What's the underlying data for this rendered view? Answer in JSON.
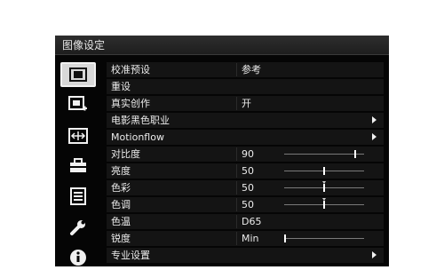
{
  "menu": {
    "title": "图像设定"
  },
  "sidebar": {
    "tabs": [
      {
        "icon": "picture-icon",
        "active": true
      },
      {
        "icon": "picture-plus-icon",
        "active": false
      },
      {
        "icon": "screen-adjust-icon",
        "active": false
      },
      {
        "icon": "toolbox-icon",
        "active": false
      },
      {
        "icon": "list-icon",
        "active": false
      },
      {
        "icon": "wrench-icon",
        "active": false
      },
      {
        "icon": "info-icon",
        "active": false
      }
    ]
  },
  "settings": {
    "rows": [
      {
        "label": "校准预设",
        "value": "参考",
        "type": "value"
      },
      {
        "label": "重设",
        "type": "action"
      },
      {
        "label": "真实创作",
        "value": "开",
        "type": "value"
      },
      {
        "label": "电影黑色职业",
        "type": "submenu"
      },
      {
        "label": "Motionflow",
        "type": "submenu"
      },
      {
        "label": "对比度",
        "value": "90",
        "type": "slider",
        "level": 0.9,
        "center_mark": false
      },
      {
        "label": "亮度",
        "value": "50",
        "type": "slider",
        "level": 0.5,
        "center_mark": false
      },
      {
        "label": "色彩",
        "value": "50",
        "type": "slider",
        "level": 0.5,
        "center_mark": true
      },
      {
        "label": "色调",
        "value": "50",
        "type": "slider",
        "level": 0.5,
        "center_mark": true
      },
      {
        "label": "色温",
        "value": "D65",
        "type": "value"
      },
      {
        "label": "锐度",
        "value": "Min",
        "type": "slider",
        "level": 0.0,
        "center_mark": false
      },
      {
        "label": "专业设置",
        "type": "submenu"
      }
    ]
  },
  "colors": {
    "background": "#050505",
    "row": "#141414",
    "text": "#ececec",
    "active_tab": "#d8d8d8"
  }
}
